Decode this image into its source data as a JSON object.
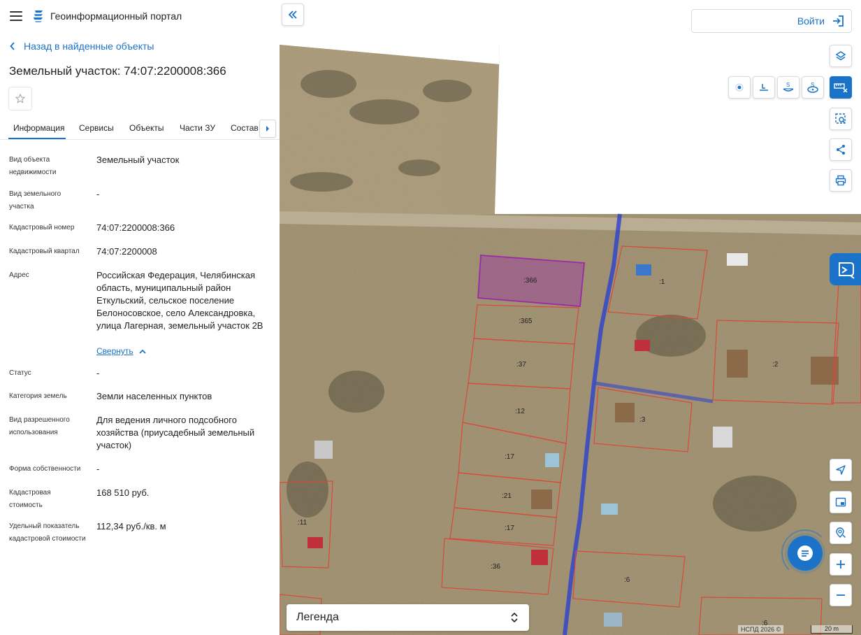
{
  "header": {
    "app_title": "Геоинформационный портал"
  },
  "nav": {
    "back_label": "Назад в найденные объекты"
  },
  "object": {
    "title": "Земельный участок: 74:07:2200008:366"
  },
  "tabs": [
    {
      "label": "Информация",
      "active": true
    },
    {
      "label": "Сервисы"
    },
    {
      "label": "Объекты"
    },
    {
      "label": "Части ЗУ"
    },
    {
      "label": "Состав"
    }
  ],
  "fields": [
    {
      "label": "Вид объекта недвижимости",
      "value": "Земельный участок"
    },
    {
      "label": "Вид земельного участка",
      "value": "-"
    },
    {
      "label": "Кадастровый номер",
      "value": "74:07:2200008:366"
    },
    {
      "label": "Кадастровый квартал",
      "value": "74:07:2200008"
    },
    {
      "label": "Адрес",
      "value": "Российская Федерация, Челябинская область, муниципальный район Еткульский, сельское поселение Белоносовское, село Александровка, улица Лагерная, земельный участок 2В"
    },
    {
      "label": "Статус",
      "value": "-"
    },
    {
      "label": "Категория земель",
      "value": "Земли населенных пунктов"
    },
    {
      "label": "Вид разрешенного использования",
      "value": "Для ведения личного подсобного хозяйства (приусадебный земельный участок)"
    },
    {
      "label": "Форма собственности",
      "value": "-"
    },
    {
      "label": "Кадастровая стоимость",
      "value": "168 510 руб."
    },
    {
      "label": "Удельный показатель кадастровой стоимости",
      "value": "112,34 руб./кв. м"
    }
  ],
  "address_collapse_label": "Свернуть",
  "map": {
    "login_label": "Войти",
    "legend_label": "Легенда",
    "copyright": "НСПД 2026 ©",
    "scale_label": "20 m",
    "parcel_labels": [
      ":366",
      ":365",
      ":37",
      ":12",
      ":17",
      ":21",
      ":17",
      ":36",
      ":1",
      ":2",
      ":3",
      ":6",
      ":11",
      ":6"
    ]
  },
  "colors": {
    "accent": "#1a73c8",
    "selected_parcel": "#9b2aa8",
    "parcel_border": "#d9483a",
    "road_line": "#3246c8"
  }
}
